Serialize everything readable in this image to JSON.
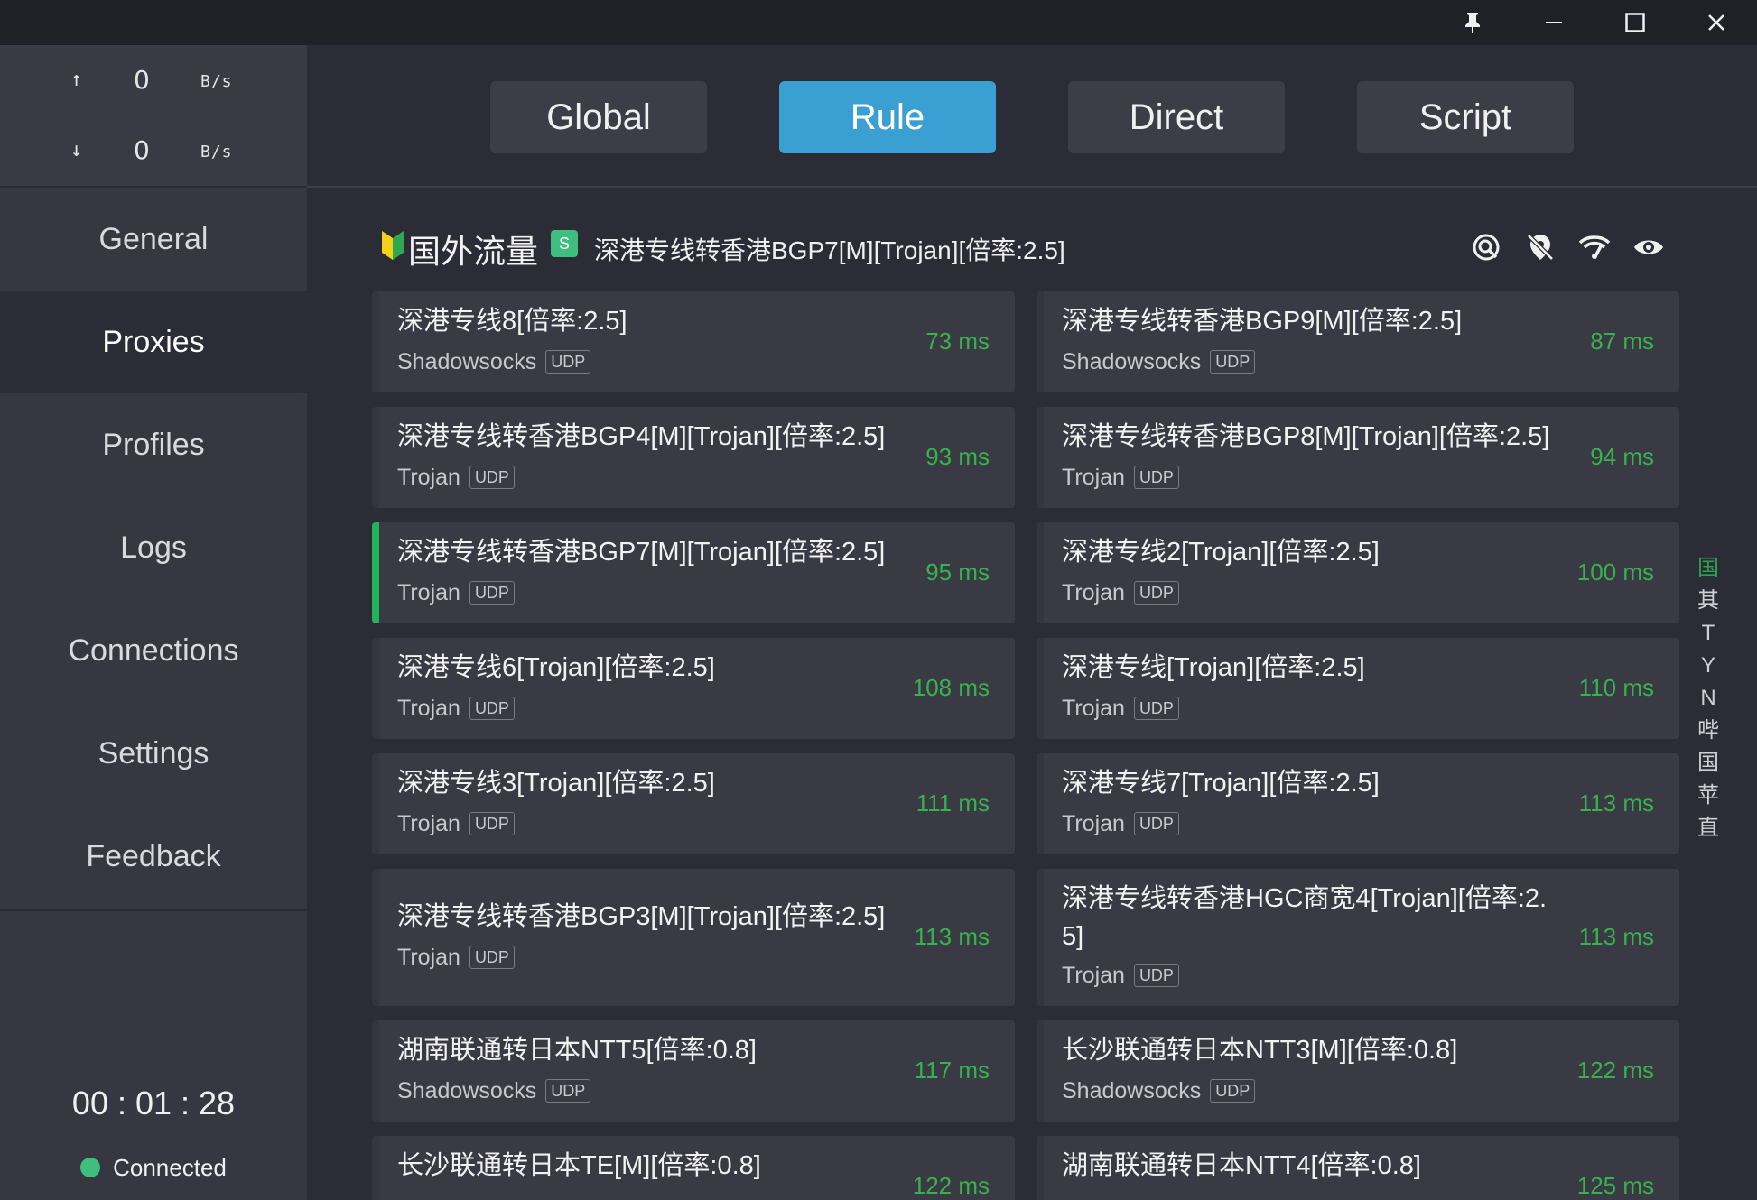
{
  "titlebar": {
    "pin_icon": "pin-icon",
    "minimize_icon": "minimize-icon",
    "maximize_icon": "maximize-icon",
    "close_icon": "close-icon"
  },
  "traffic": {
    "up_arrow": "↑",
    "down_arrow": "↓",
    "upload_value": "0",
    "download_value": "0",
    "unit": "B/s"
  },
  "nav": {
    "items": [
      "General",
      "Proxies",
      "Profiles",
      "Logs",
      "Connections",
      "Settings",
      "Feedback"
    ],
    "active": "Proxies"
  },
  "runtime": "00 : 01 : 28",
  "status": "Connected",
  "modes": {
    "items": [
      "Global",
      "Rule",
      "Direct",
      "Script"
    ],
    "active": "Rule"
  },
  "group": {
    "name": "国外流量",
    "badge": "S",
    "selected": "深港专线转香港BGP7[M][Trojan][倍率:2.5]",
    "icons": [
      "search-location-icon",
      "no-location-icon",
      "wifi-speed-icon",
      "eye-icon"
    ]
  },
  "proxies": [
    {
      "name": "深港专线8[倍率:2.5]",
      "type": "Shadowsocks",
      "udp": "UDP",
      "delay": "73 ms"
    },
    {
      "name": "深港专线转香港BGP9[M][倍率:2.5]",
      "type": "Shadowsocks",
      "udp": "UDP",
      "delay": "87 ms"
    },
    {
      "name": "深港专线转香港BGP4[M][Trojan][倍率:2.5]",
      "type": "Trojan",
      "udp": "UDP",
      "delay": "93 ms"
    },
    {
      "name": "深港专线转香港BGP8[M][Trojan][倍率:2.5]",
      "type": "Trojan",
      "udp": "UDP",
      "delay": "94 ms"
    },
    {
      "name": "深港专线转香港BGP7[M][Trojan][倍率:2.5]",
      "type": "Trojan",
      "udp": "UDP",
      "delay": "95 ms",
      "selected": true
    },
    {
      "name": "深港专线2[Trojan][倍率:2.5]",
      "type": "Trojan",
      "udp": "UDP",
      "delay": "100 ms"
    },
    {
      "name": "深港专线6[Trojan][倍率:2.5]",
      "type": "Trojan",
      "udp": "UDP",
      "delay": "108 ms"
    },
    {
      "name": "深港专线[Trojan][倍率:2.5]",
      "type": "Trojan",
      "udp": "UDP",
      "delay": "110 ms"
    },
    {
      "name": "深港专线3[Trojan][倍率:2.5]",
      "type": "Trojan",
      "udp": "UDP",
      "delay": "111 ms"
    },
    {
      "name": "深港专线7[Trojan][倍率:2.5]",
      "type": "Trojan",
      "udp": "UDP",
      "delay": "113 ms"
    },
    {
      "name": "深港专线转香港BGP3[M][Trojan][倍率:2.5]",
      "type": "Trojan",
      "udp": "UDP",
      "delay": "113 ms"
    },
    {
      "name": "深港专线转香港HGC商宽4[Trojan][倍率:2.5]",
      "type": "Trojan",
      "udp": "UDP",
      "delay": "113 ms"
    },
    {
      "name": "湖南联通转日本NTT5[倍率:0.8]",
      "type": "Shadowsocks",
      "udp": "UDP",
      "delay": "117 ms"
    },
    {
      "name": "长沙联通转日本NTT3[M][倍率:0.8]",
      "type": "Shadowsocks",
      "udp": "UDP",
      "delay": "122 ms"
    },
    {
      "name": "长沙联通转日本TE[M][倍率:0.8]",
      "type": "",
      "udp": "",
      "delay": "122 ms"
    },
    {
      "name": "湖南联通转日本NTT4[倍率:0.8]",
      "type": "",
      "udp": "",
      "delay": "125 ms"
    }
  ],
  "index_letters": [
    "国",
    "其",
    "T",
    "Y",
    "N",
    "哔",
    "国",
    "苹",
    "直"
  ],
  "colors": {
    "accent": "#3aa0d3",
    "delay_green": "#37b24d",
    "selected_bar": "#22b45a",
    "connected_dot": "#3fbf7f"
  }
}
